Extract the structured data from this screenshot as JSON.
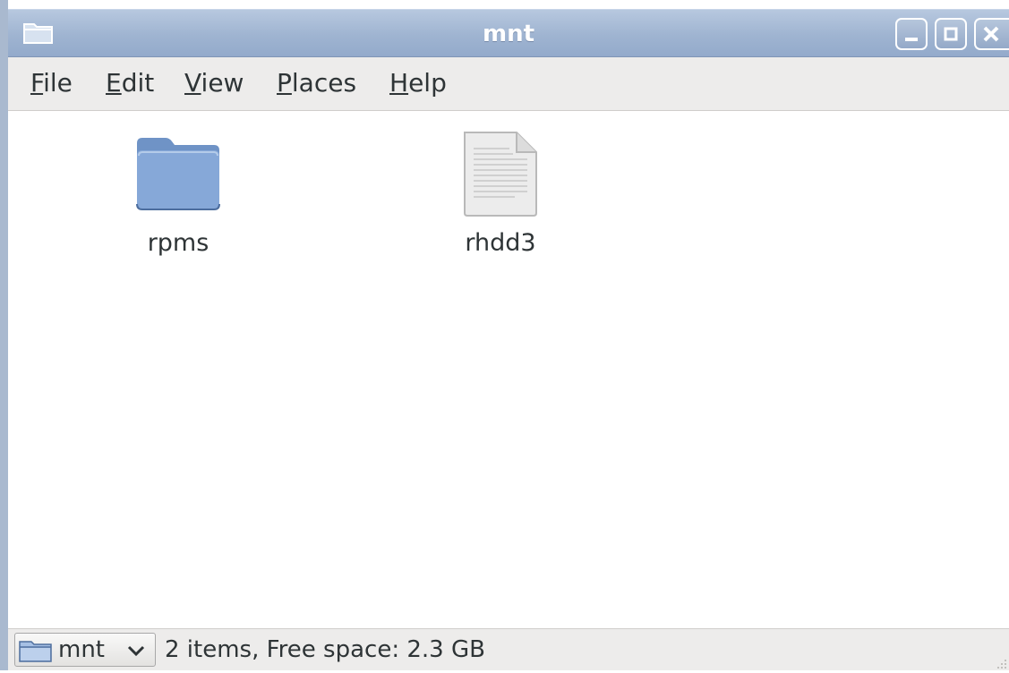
{
  "window": {
    "title": "mnt",
    "title_icon": "folder-icon",
    "controls": [
      "minimize-icon",
      "maximize-icon",
      "close-icon"
    ]
  },
  "menu": {
    "items": [
      {
        "mnemonic": "F",
        "rest": "ile"
      },
      {
        "mnemonic": "E",
        "rest": "dit"
      },
      {
        "mnemonic": "V",
        "rest": "iew"
      },
      {
        "mnemonic": "P",
        "rest": "laces"
      },
      {
        "mnemonic": "H",
        "rest": "elp"
      }
    ]
  },
  "files": [
    {
      "name": "rpms",
      "icon": "folder-icon"
    },
    {
      "name": "rhdd3",
      "icon": "text-file-icon"
    }
  ],
  "statusbar": {
    "location": "mnt",
    "location_icon": "folder-icon",
    "status": "2 items, Free space: 2.3 GB"
  },
  "colors": {
    "titlebar": "#9fb4d1",
    "folder": "#7fa3d1",
    "menubar": "#edeceb"
  }
}
